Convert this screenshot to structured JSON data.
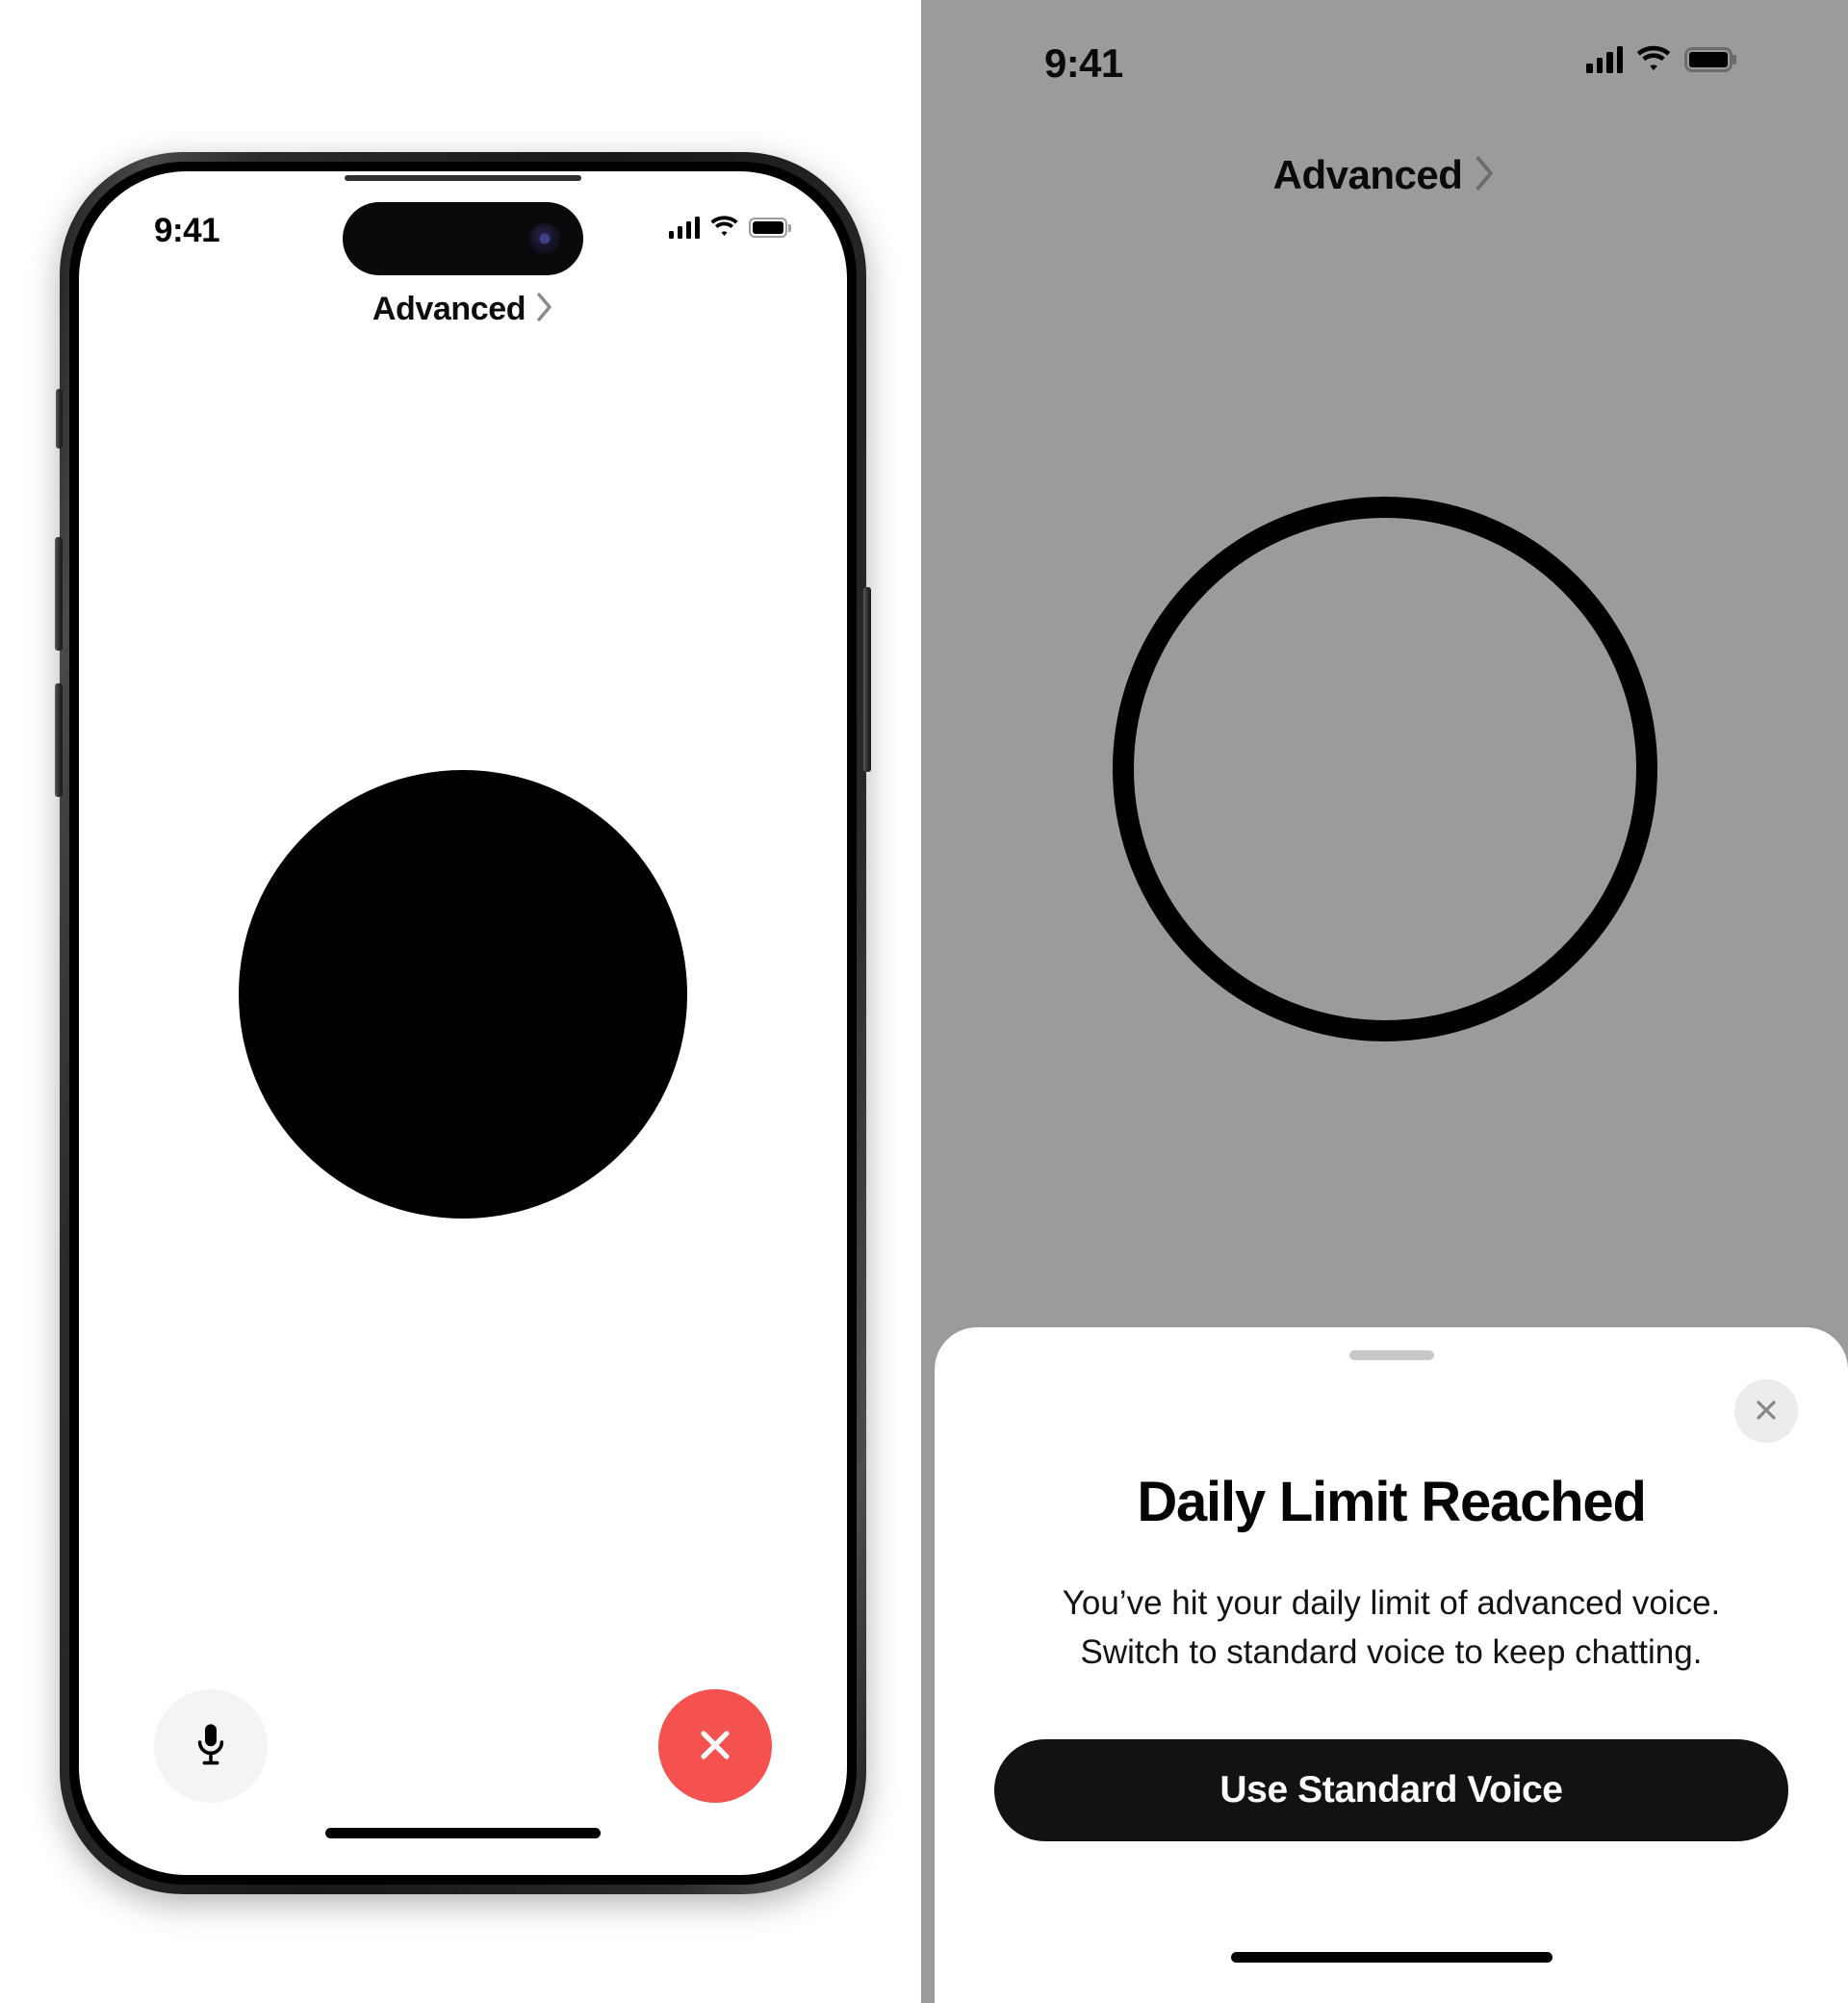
{
  "left_panel": {
    "device": {
      "name": "iPhone device mockup",
      "frame_color": "#1d1d1f"
    },
    "status_bar": {
      "time": "9:41",
      "cellular_icon": "cellular-signal-icon",
      "wifi_icon": "wifi-icon",
      "battery_icon": "battery-icon"
    },
    "header": {
      "label": "Advanced",
      "chevron_icon": "chevron-right-icon"
    },
    "orb": {
      "name": "voice-orb",
      "state": "filled",
      "color": "#000000"
    },
    "controls": {
      "mic_icon": "microphone-icon",
      "mic_background": "#f4f4f6",
      "end_icon": "close-x-icon",
      "end_background": "#f4514f"
    },
    "home_indicator": "home-indicator"
  },
  "right_panel": {
    "background_color": "#9b9a9d",
    "status_bar": {
      "time": "9:41",
      "cellular_icon": "cellular-signal-icon",
      "wifi_icon": "wifi-icon",
      "battery_icon": "battery-icon"
    },
    "header": {
      "label": "Advanced",
      "chevron_icon": "chevron-right-icon"
    },
    "orb": {
      "name": "voice-orb-ring",
      "state": "outline",
      "color": "#000000"
    },
    "sheet": {
      "grabber": "sheet-grabber",
      "close_icon": "close-x-icon",
      "title": "Daily Limit Reached",
      "body_line_1": "You’ve hit your daily limit of advanced voice.",
      "body_line_2": "Switch to standard voice to keep chatting.",
      "primary_button_label": "Use Standard Voice",
      "primary_button_color": "#121212"
    },
    "home_indicator": "home-indicator"
  }
}
